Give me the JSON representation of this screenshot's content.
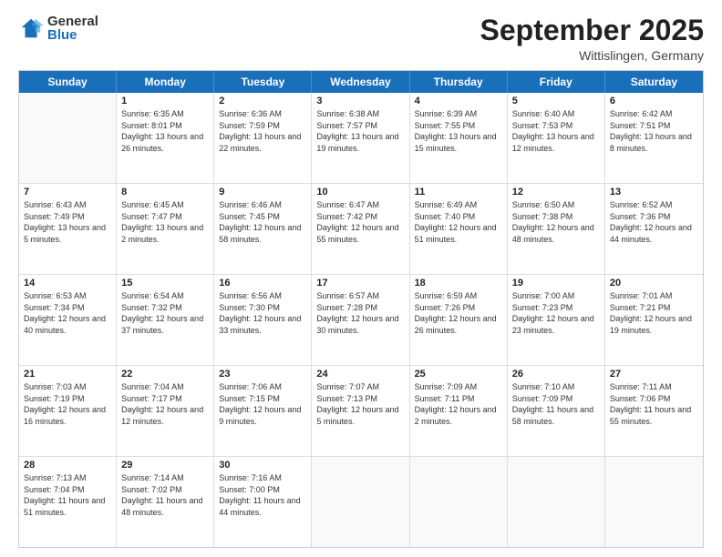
{
  "header": {
    "logo": {
      "general": "General",
      "blue": "Blue"
    },
    "title": "September 2025",
    "subtitle": "Wittislingen, Germany"
  },
  "weekdays": [
    "Sunday",
    "Monday",
    "Tuesday",
    "Wednesday",
    "Thursday",
    "Friday",
    "Saturday"
  ],
  "weeks": [
    [
      {
        "day": "",
        "sunrise": "",
        "sunset": "",
        "daylight": "",
        "empty": true
      },
      {
        "day": "1",
        "sunrise": "Sunrise: 6:35 AM",
        "sunset": "Sunset: 8:01 PM",
        "daylight": "Daylight: 13 hours and 26 minutes."
      },
      {
        "day": "2",
        "sunrise": "Sunrise: 6:36 AM",
        "sunset": "Sunset: 7:59 PM",
        "daylight": "Daylight: 13 hours and 22 minutes."
      },
      {
        "day": "3",
        "sunrise": "Sunrise: 6:38 AM",
        "sunset": "Sunset: 7:57 PM",
        "daylight": "Daylight: 13 hours and 19 minutes."
      },
      {
        "day": "4",
        "sunrise": "Sunrise: 6:39 AM",
        "sunset": "Sunset: 7:55 PM",
        "daylight": "Daylight: 13 hours and 15 minutes."
      },
      {
        "day": "5",
        "sunrise": "Sunrise: 6:40 AM",
        "sunset": "Sunset: 7:53 PM",
        "daylight": "Daylight: 13 hours and 12 minutes."
      },
      {
        "day": "6",
        "sunrise": "Sunrise: 6:42 AM",
        "sunset": "Sunset: 7:51 PM",
        "daylight": "Daylight: 13 hours and 8 minutes."
      }
    ],
    [
      {
        "day": "7",
        "sunrise": "Sunrise: 6:43 AM",
        "sunset": "Sunset: 7:49 PM",
        "daylight": "Daylight: 13 hours and 5 minutes."
      },
      {
        "day": "8",
        "sunrise": "Sunrise: 6:45 AM",
        "sunset": "Sunset: 7:47 PM",
        "daylight": "Daylight: 13 hours and 2 minutes."
      },
      {
        "day": "9",
        "sunrise": "Sunrise: 6:46 AM",
        "sunset": "Sunset: 7:45 PM",
        "daylight": "Daylight: 12 hours and 58 minutes."
      },
      {
        "day": "10",
        "sunrise": "Sunrise: 6:47 AM",
        "sunset": "Sunset: 7:42 PM",
        "daylight": "Daylight: 12 hours and 55 minutes."
      },
      {
        "day": "11",
        "sunrise": "Sunrise: 6:49 AM",
        "sunset": "Sunset: 7:40 PM",
        "daylight": "Daylight: 12 hours and 51 minutes."
      },
      {
        "day": "12",
        "sunrise": "Sunrise: 6:50 AM",
        "sunset": "Sunset: 7:38 PM",
        "daylight": "Daylight: 12 hours and 48 minutes."
      },
      {
        "day": "13",
        "sunrise": "Sunrise: 6:52 AM",
        "sunset": "Sunset: 7:36 PM",
        "daylight": "Daylight: 12 hours and 44 minutes."
      }
    ],
    [
      {
        "day": "14",
        "sunrise": "Sunrise: 6:53 AM",
        "sunset": "Sunset: 7:34 PM",
        "daylight": "Daylight: 12 hours and 40 minutes."
      },
      {
        "day": "15",
        "sunrise": "Sunrise: 6:54 AM",
        "sunset": "Sunset: 7:32 PM",
        "daylight": "Daylight: 12 hours and 37 minutes."
      },
      {
        "day": "16",
        "sunrise": "Sunrise: 6:56 AM",
        "sunset": "Sunset: 7:30 PM",
        "daylight": "Daylight: 12 hours and 33 minutes."
      },
      {
        "day": "17",
        "sunrise": "Sunrise: 6:57 AM",
        "sunset": "Sunset: 7:28 PM",
        "daylight": "Daylight: 12 hours and 30 minutes."
      },
      {
        "day": "18",
        "sunrise": "Sunrise: 6:59 AM",
        "sunset": "Sunset: 7:26 PM",
        "daylight": "Daylight: 12 hours and 26 minutes."
      },
      {
        "day": "19",
        "sunrise": "Sunrise: 7:00 AM",
        "sunset": "Sunset: 7:23 PM",
        "daylight": "Daylight: 12 hours and 23 minutes."
      },
      {
        "day": "20",
        "sunrise": "Sunrise: 7:01 AM",
        "sunset": "Sunset: 7:21 PM",
        "daylight": "Daylight: 12 hours and 19 minutes."
      }
    ],
    [
      {
        "day": "21",
        "sunrise": "Sunrise: 7:03 AM",
        "sunset": "Sunset: 7:19 PM",
        "daylight": "Daylight: 12 hours and 16 minutes."
      },
      {
        "day": "22",
        "sunrise": "Sunrise: 7:04 AM",
        "sunset": "Sunset: 7:17 PM",
        "daylight": "Daylight: 12 hours and 12 minutes."
      },
      {
        "day": "23",
        "sunrise": "Sunrise: 7:06 AM",
        "sunset": "Sunset: 7:15 PM",
        "daylight": "Daylight: 12 hours and 9 minutes."
      },
      {
        "day": "24",
        "sunrise": "Sunrise: 7:07 AM",
        "sunset": "Sunset: 7:13 PM",
        "daylight": "Daylight: 12 hours and 5 minutes."
      },
      {
        "day": "25",
        "sunrise": "Sunrise: 7:09 AM",
        "sunset": "Sunset: 7:11 PM",
        "daylight": "Daylight: 12 hours and 2 minutes."
      },
      {
        "day": "26",
        "sunrise": "Sunrise: 7:10 AM",
        "sunset": "Sunset: 7:09 PM",
        "daylight": "Daylight: 11 hours and 58 minutes."
      },
      {
        "day": "27",
        "sunrise": "Sunrise: 7:11 AM",
        "sunset": "Sunset: 7:06 PM",
        "daylight": "Daylight: 11 hours and 55 minutes."
      }
    ],
    [
      {
        "day": "28",
        "sunrise": "Sunrise: 7:13 AM",
        "sunset": "Sunset: 7:04 PM",
        "daylight": "Daylight: 11 hours and 51 minutes."
      },
      {
        "day": "29",
        "sunrise": "Sunrise: 7:14 AM",
        "sunset": "Sunset: 7:02 PM",
        "daylight": "Daylight: 11 hours and 48 minutes."
      },
      {
        "day": "30",
        "sunrise": "Sunrise: 7:16 AM",
        "sunset": "Sunset: 7:00 PM",
        "daylight": "Daylight: 11 hours and 44 minutes."
      },
      {
        "day": "",
        "sunrise": "",
        "sunset": "",
        "daylight": "",
        "empty": true
      },
      {
        "day": "",
        "sunrise": "",
        "sunset": "",
        "daylight": "",
        "empty": true
      },
      {
        "day": "",
        "sunrise": "",
        "sunset": "",
        "daylight": "",
        "empty": true
      },
      {
        "day": "",
        "sunrise": "",
        "sunset": "",
        "daylight": "",
        "empty": true
      }
    ]
  ]
}
